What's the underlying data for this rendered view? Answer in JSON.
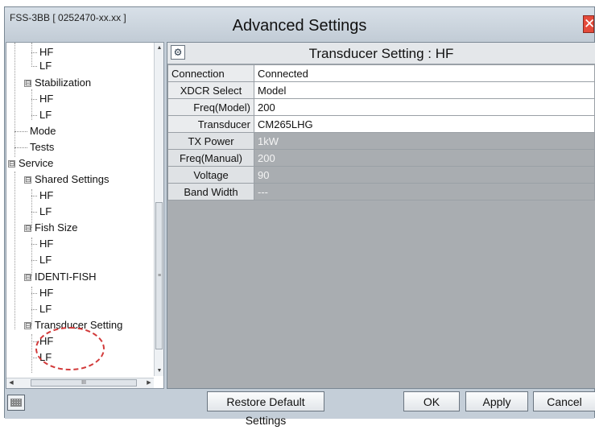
{
  "window": {
    "title": "Advanced Settings",
    "device_id": "FSS-3BB [ 0252470-xx.xx ]",
    "close_symbol": "✕"
  },
  "tree": {
    "items": [
      {
        "label": "HF"
      },
      {
        "label": "LF"
      },
      {
        "label": "Stabilization",
        "expander": "⊟"
      },
      {
        "label": "HF"
      },
      {
        "label": "LF"
      },
      {
        "label": "Mode"
      },
      {
        "label": "Tests"
      },
      {
        "label": "Service",
        "expander": "⊟"
      },
      {
        "label": "Shared Settings",
        "expander": "⊟"
      },
      {
        "label": "HF"
      },
      {
        "label": "LF"
      },
      {
        "label": "Fish Size",
        "expander": "⊟"
      },
      {
        "label": "HF"
      },
      {
        "label": "LF"
      },
      {
        "label": "IDENTI-FISH",
        "expander": "⊟"
      },
      {
        "label": "HF"
      },
      {
        "label": "LF"
      },
      {
        "label": "Transducer Setting",
        "expander": "⊟"
      },
      {
        "label": "HF"
      },
      {
        "label": "LF"
      }
    ],
    "scroll_up": "▲",
    "scroll_down": "▼",
    "scroll_left": "◀",
    "scroll_right": "▶",
    "grip": "III",
    "vgrip": "≡"
  },
  "panel": {
    "title": "Transducer Setting : HF",
    "icon": "gear-icon",
    "icon_glyph": "⚙",
    "rows": [
      {
        "label": "Connection",
        "value": "Connected",
        "enabled": true
      },
      {
        "label": "XDCR Select",
        "value": "Model",
        "enabled": true
      },
      {
        "label": "Freq(Model)",
        "value": "200",
        "enabled": true
      },
      {
        "label": "Transducer",
        "value": "CM265LHG",
        "enabled": true
      },
      {
        "label": "TX Power",
        "value": "1kW",
        "enabled": false
      },
      {
        "label": "Freq(Manual)",
        "value": "200",
        "enabled": false
      },
      {
        "label": "Voltage",
        "value": "90",
        "enabled": false
      },
      {
        "label": "Band Width",
        "value": "---",
        "enabled": false
      }
    ]
  },
  "buttons": {
    "restore": "Restore Default Settings",
    "ok": "OK",
    "apply": "Apply",
    "cancel": "Cancel"
  },
  "colors": {
    "highlight_circle": "#d23a3a",
    "close_button": "#e44a3a",
    "disabled_row": "#a9adb1"
  }
}
